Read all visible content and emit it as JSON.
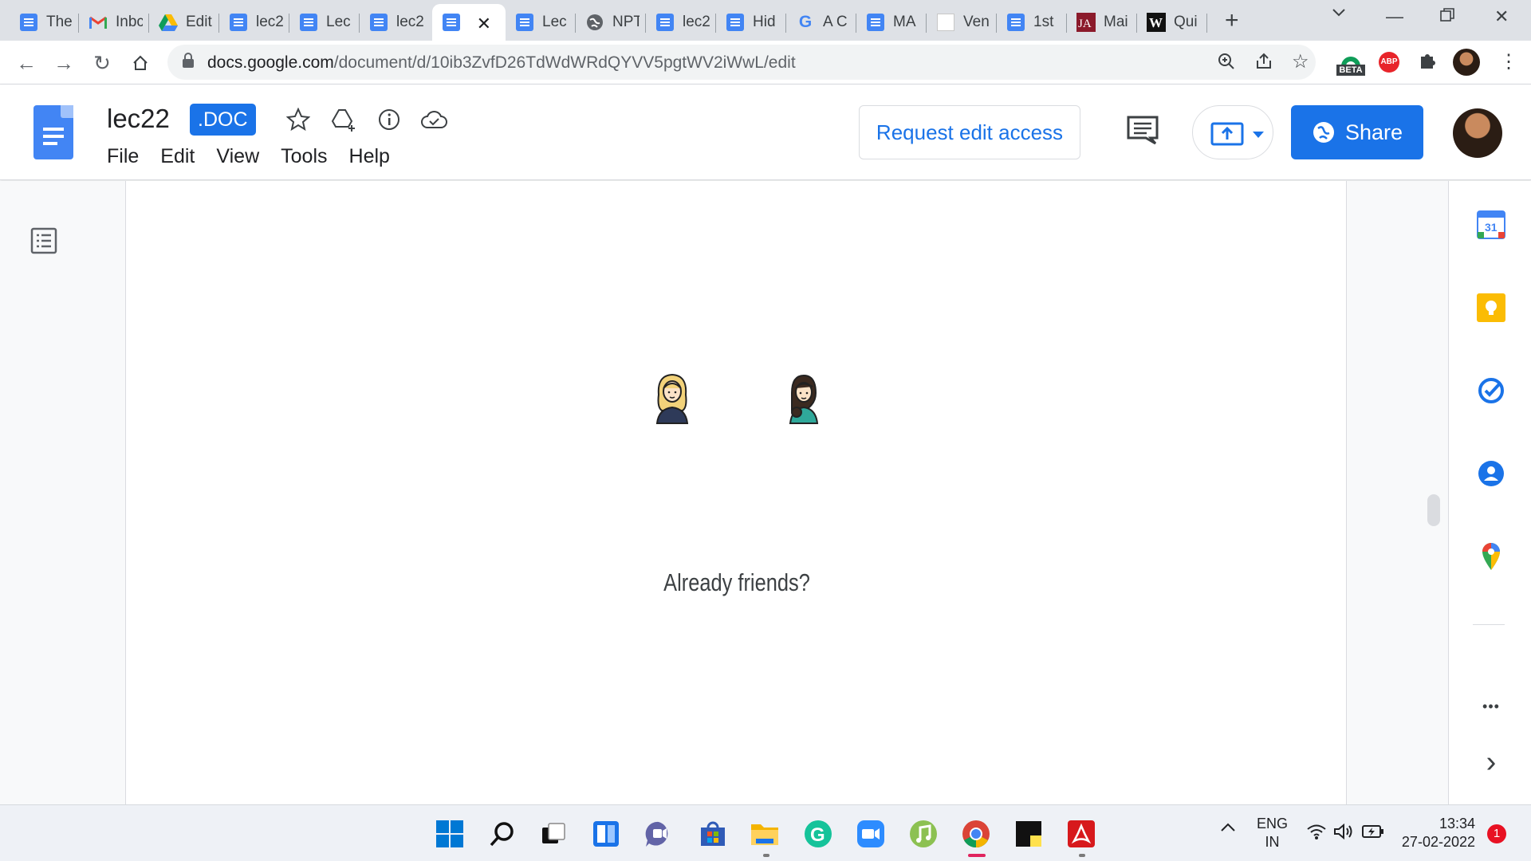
{
  "browser": {
    "tabs": [
      {
        "title": "The",
        "icon": "google-docs-icon"
      },
      {
        "title": "Inbc",
        "icon": "gmail-icon"
      },
      {
        "title": "Edit",
        "icon": "google-drive-icon"
      },
      {
        "title": "lec2",
        "icon": "google-docs-icon"
      },
      {
        "title": "Lec",
        "icon": "google-docs-icon"
      },
      {
        "title": "lec2",
        "icon": "google-docs-icon"
      },
      {
        "title": "",
        "icon": "google-docs-icon",
        "active": true
      },
      {
        "title": "Lec",
        "icon": "google-docs-icon"
      },
      {
        "title": "NPT",
        "icon": "globe-icon"
      },
      {
        "title": "lec2",
        "icon": "google-docs-icon"
      },
      {
        "title": "Hid",
        "icon": "google-docs-icon"
      },
      {
        "title": "A C",
        "icon": "google-icon"
      },
      {
        "title": "MA",
        "icon": "google-docs-icon"
      },
      {
        "title": "Ven",
        "icon": "blank-page-icon"
      },
      {
        "title": "1st",
        "icon": "google-docs-icon"
      },
      {
        "title": "Mai",
        "icon": "ja-icon"
      },
      {
        "title": "Qui",
        "icon": "w-icon"
      }
    ],
    "active_tab_close": "✕",
    "url_host": "docs.google.com",
    "url_path": "/document/d/10ib3ZvfD26TdWdWRdQYVV5pgtWV2iWwL/edit",
    "extension_badge": "BETA",
    "abp_label": "ABP"
  },
  "docs": {
    "title": "lec22",
    "badge": ".DOC",
    "menu": [
      "File",
      "Edit",
      "View",
      "Tools",
      "Help"
    ],
    "request_edit_label": "Request edit access",
    "share_label": "Share",
    "brand_color": "#1a73e8"
  },
  "document": {
    "caption": "Already friends?"
  },
  "sidepanel": {
    "calendar_day": "31",
    "more": "•••",
    "collapse": "›"
  },
  "taskbar": {
    "lang_top": "ENG",
    "lang_bottom": "IN",
    "time": "13:34",
    "date": "27-02-2022",
    "notification_count": "1"
  }
}
